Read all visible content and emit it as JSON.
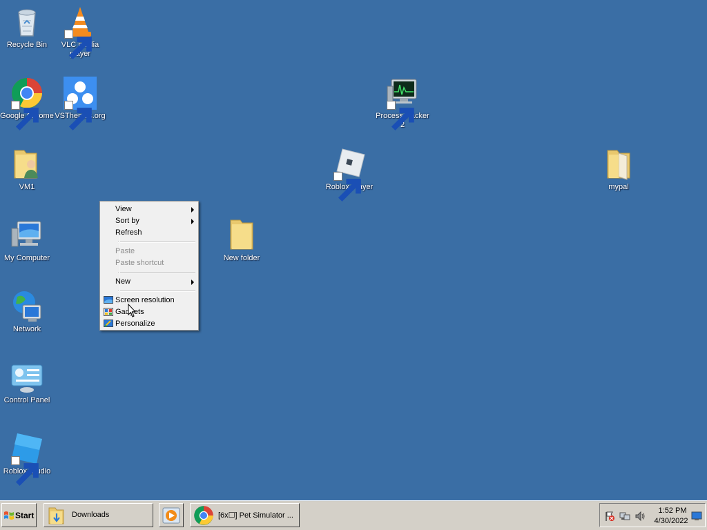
{
  "desktop": {
    "icons": [
      {
        "label": "Recycle Bin"
      },
      {
        "label": "VLC media player"
      },
      {
        "label": "Google Chrome"
      },
      {
        "label": "VSThemes.org"
      },
      {
        "label": "Process Hacker 2"
      },
      {
        "label": "VM1"
      },
      {
        "label": "Roblox Player"
      },
      {
        "label": "mypal"
      },
      {
        "label": "My Computer"
      },
      {
        "label": "New folder"
      },
      {
        "label": "Network"
      },
      {
        "label": "Control Panel"
      },
      {
        "label": "Roblox Studio"
      }
    ]
  },
  "context_menu": {
    "view": "View",
    "sort_by": "Sort by",
    "refresh": "Refresh",
    "paste": "Paste",
    "paste_shortcut": "Paste shortcut",
    "new": "New",
    "screen_resolution": "Screen resolution",
    "gadgets": "Gadgets",
    "personalize": "Personalize"
  },
  "taskbar": {
    "start_label": "Start",
    "tasks": [
      {
        "label": "Downloads",
        "icon": "folder-icon"
      },
      {
        "label": "",
        "icon": "media-player-icon"
      },
      {
        "label": "[6x☐] Pet Simulator ...",
        "icon": "chrome-icon"
      }
    ],
    "tray": {
      "icons": [
        "action-center-flag-icon",
        "network-icon",
        "volume-icon",
        "show-desktop-icon"
      ],
      "time": "1:52 PM",
      "date": "4/30/2022"
    }
  },
  "colors": {
    "desktop_bg": "#3a6ea5",
    "taskbar_bg": "#d4d0c8",
    "menu_bg": "#f0f0f0"
  }
}
